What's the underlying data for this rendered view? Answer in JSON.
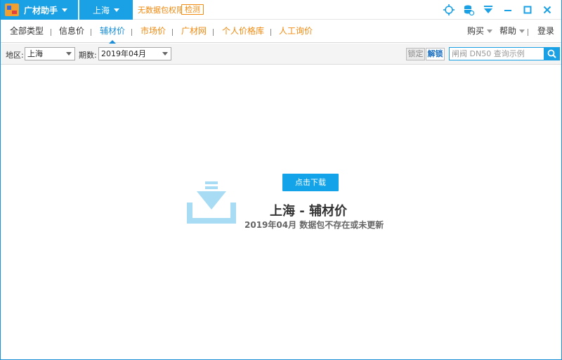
{
  "window": {
    "brand": "广材助手",
    "region": "上海",
    "notice": "无数据包权限",
    "check_button": "检测"
  },
  "nav": {
    "items": [
      {
        "label": "全部类型"
      },
      {
        "label": "信息价"
      },
      {
        "label": "辅材价"
      },
      {
        "label": "市场价"
      },
      {
        "label": "广材网"
      },
      {
        "label": "个人价格库"
      },
      {
        "label": "人工询价"
      }
    ],
    "buy": "购买",
    "help": "帮助",
    "login": "登录"
  },
  "filter": {
    "region_label": "地区:",
    "region_value": "上海",
    "period_label": "期数:",
    "period_value": "2019年04月",
    "lock_button": "锁定",
    "unlock_button": "解锁",
    "search_placeholder": "闸阀 DN50 查询示例"
  },
  "main": {
    "download_button": "点击下载",
    "title": "上海 - 辅材价",
    "subtitle": "2019年04月 数据包不存在或未更新"
  },
  "colors": {
    "accent": "#1aa0e4",
    "orange": "#f08a10",
    "icon_light": "#a8dcf5"
  }
}
